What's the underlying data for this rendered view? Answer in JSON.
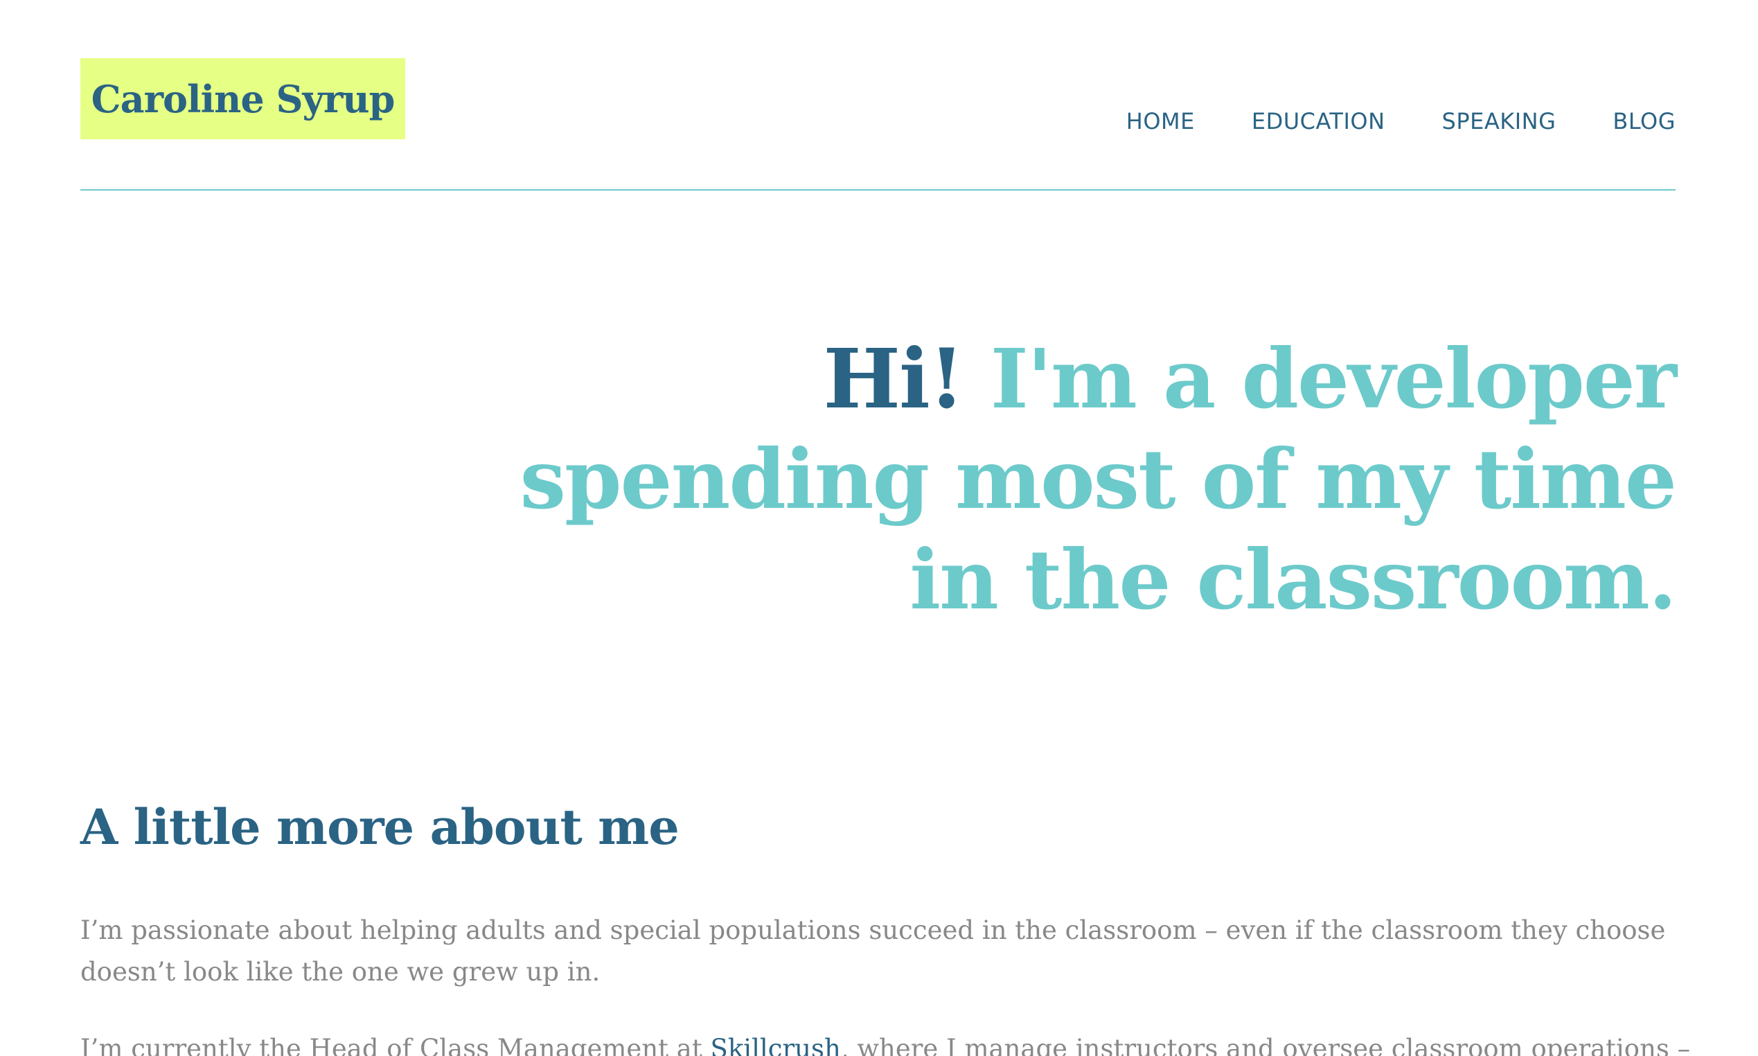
{
  "header": {
    "logo_text": "Caroline Syrup",
    "nav": [
      "HOME",
      "EDUCATION",
      "SPEAKING",
      "BLOG"
    ]
  },
  "hero": {
    "greeting": "Hi!",
    "rest": "I'm a developer spending most of my time in the classroom."
  },
  "about": {
    "heading": "A little more about me",
    "paragraph1": "I’m passionate about helping adults and special populations succeed in the classroom – even if the classroom they choose doesn’t look like the one we grew up in.",
    "paragraph2_before": "I’m currently the Head of Class Management at ",
    "paragraph2_link": "Skillcrush",
    "paragraph2_after": ", where I manage instructors and oversee classroom operations –"
  },
  "colors": {
    "navy": "#2a6384",
    "teal": "#6dcacb",
    "logo_bg": "#e6ff85",
    "body_text": "#888888"
  }
}
